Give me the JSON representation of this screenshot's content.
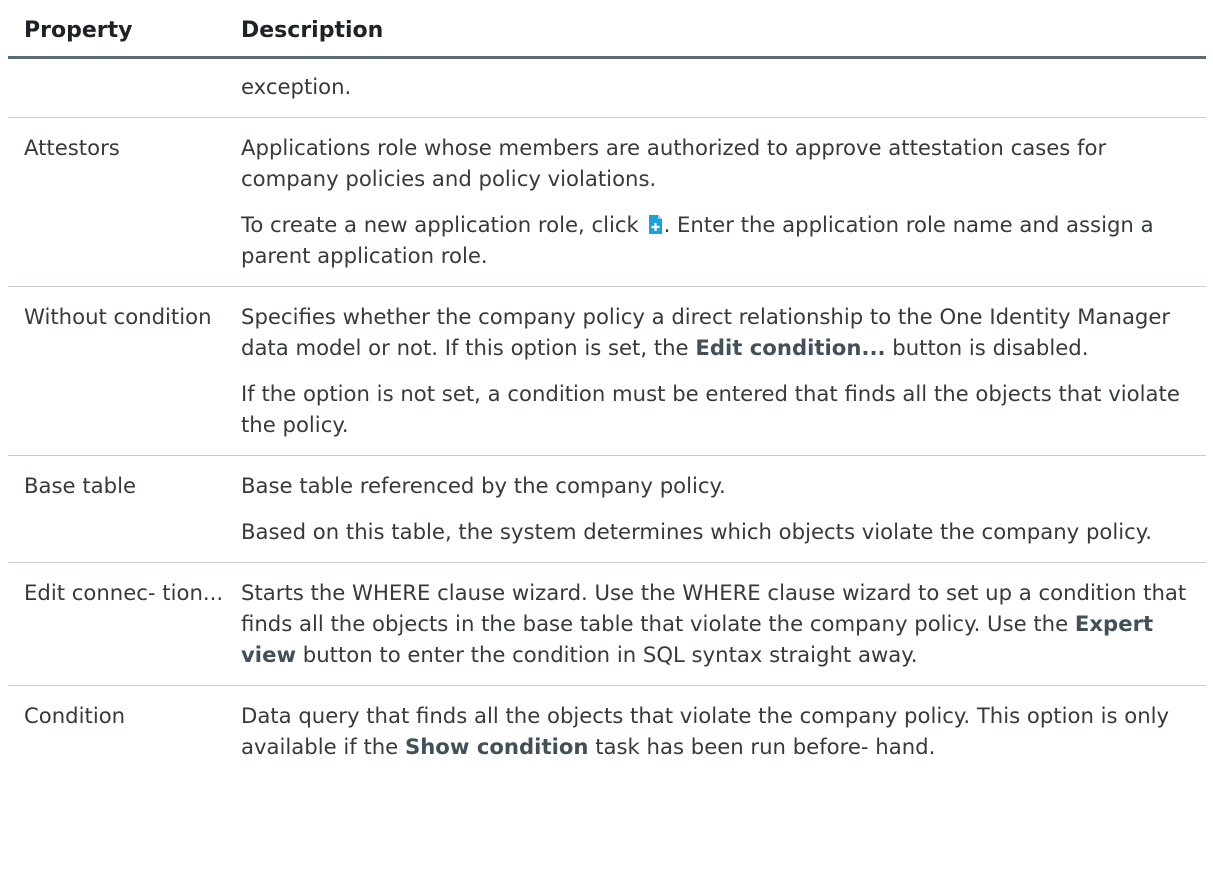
{
  "table": {
    "headers": {
      "property": "Property",
      "description": "Description"
    },
    "rows": [
      {
        "property": "",
        "paragraphs": [
          "exception."
        ]
      },
      {
        "property": "Attestors",
        "p1": "Applications role whose members are authorized to approve attestation cases for company policies and policy violations.",
        "p2_before": "To create a new application role, click ",
        "p2_icon": "add-new-icon",
        "p2_after": ". Enter the application role name and assign a parent application role."
      },
      {
        "property": "Without condition",
        "p1_before": "Specifies whether the company policy a direct relationship to the One Identity Manager data model or not. If this option is set, the ",
        "p1_bold": "Edit condition...",
        "p1_after": " button is disabled.",
        "p2": "If the option is not set, a condition must be entered that finds all the objects that violate the policy."
      },
      {
        "property": "Base table",
        "p1": "Base table referenced by the company policy.",
        "p2": "Based on this table, the system determines which objects violate the company policy."
      },
      {
        "property": "Edit connec- tion...",
        "p1_before": "Starts the WHERE clause wizard. Use the WHERE clause wizard to set up a condition that finds all the objects in the base table that violate the company policy. Use the ",
        "p1_bold": "Expert view",
        "p1_after": " button to enter the condition in SQL syntax straight away."
      },
      {
        "property": "Condition",
        "p1_before": "Data query that finds all the objects that violate the company policy. This option is only available if the ",
        "p1_bold": "Show condition",
        "p1_after": " task has been run before- hand."
      }
    ]
  },
  "colors": {
    "text": "#363a3e",
    "header_rule": "#5a6a72",
    "row_rule": "#c9cdd1",
    "icon_blue": "#1aa0e0"
  }
}
